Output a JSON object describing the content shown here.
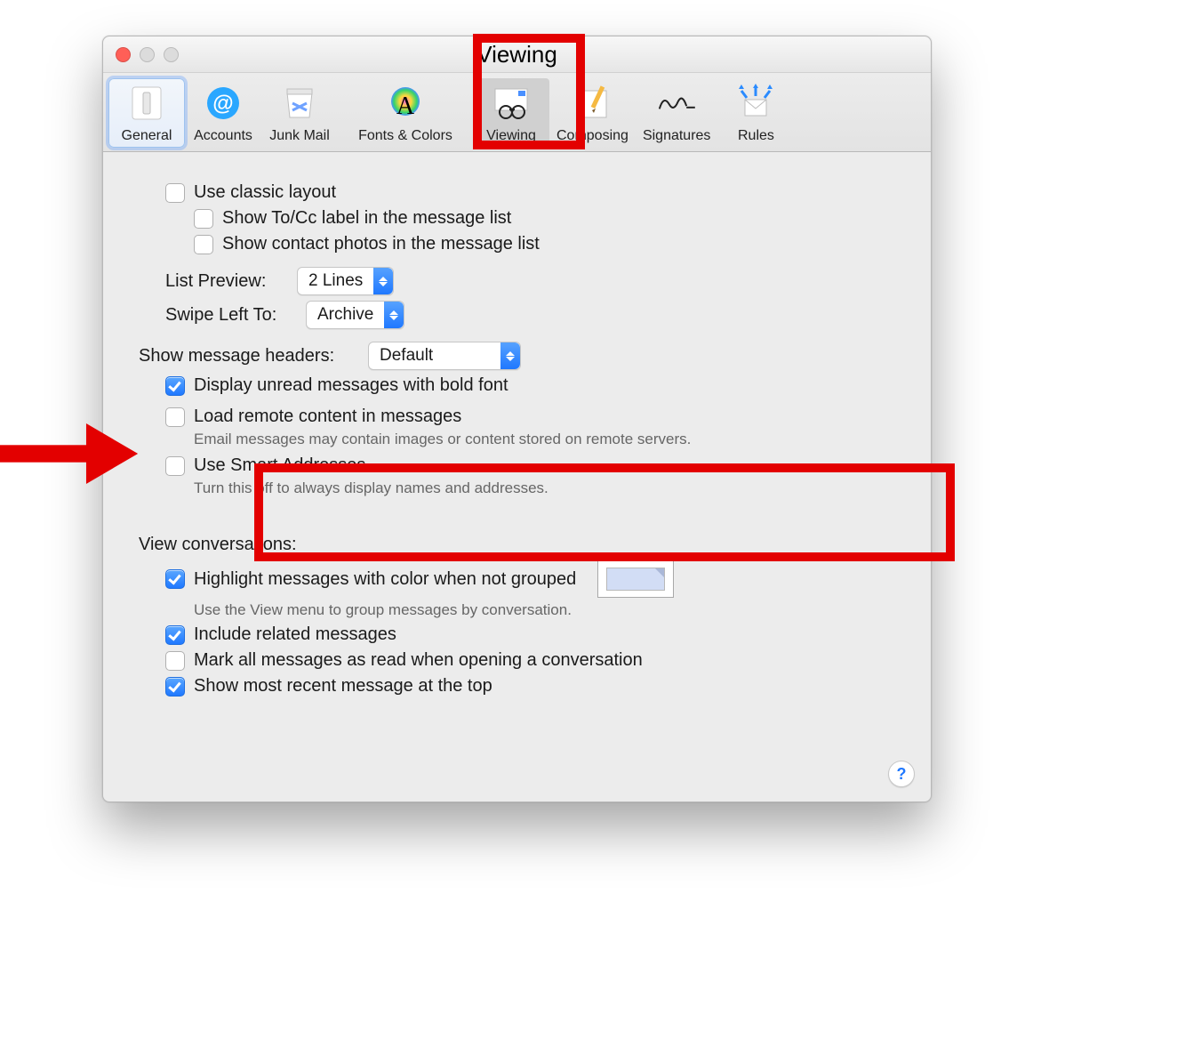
{
  "window": {
    "title": "Viewing"
  },
  "toolbar": {
    "items": [
      {
        "key": "general",
        "label": "General"
      },
      {
        "key": "accounts",
        "label": "Accounts"
      },
      {
        "key": "junk",
        "label": "Junk Mail"
      },
      {
        "key": "fonts",
        "label": "Fonts & Colors"
      },
      {
        "key": "viewing",
        "label": "Viewing"
      },
      {
        "key": "composing",
        "label": "Composing"
      },
      {
        "key": "signatures",
        "label": "Signatures"
      },
      {
        "key": "rules",
        "label": "Rules"
      }
    ]
  },
  "options": {
    "classic_layout": {
      "label": "Use classic layout",
      "checked": false
    },
    "show_to_cc": {
      "label": "Show To/Cc label in the message list",
      "checked": false
    },
    "show_contact_photos": {
      "label": "Show contact photos in the message list",
      "checked": false
    },
    "list_preview": {
      "label": "List Preview:",
      "value": "2 Lines"
    },
    "swipe_left": {
      "label": "Swipe Left To:",
      "value": "Archive"
    },
    "show_headers": {
      "label": "Show message headers:",
      "value": "Default"
    },
    "display_bold": {
      "label": "Display unread messages with bold font",
      "checked": true
    },
    "load_remote": {
      "label": "Load remote content in messages",
      "checked": false,
      "sub": "Email messages may contain images or content stored on remote servers."
    },
    "smart_addresses": {
      "label": "Use Smart Addresses",
      "checked": false,
      "sub": "Turn this off to always display names and addresses."
    },
    "view_conv_header": "View conversations:",
    "highlight": {
      "label": "Highlight messages with color when not grouped",
      "checked": true,
      "sub": "Use the View menu to group messages by conversation."
    },
    "include_related": {
      "label": "Include related messages",
      "checked": true
    },
    "mark_read": {
      "label": "Mark all messages as read when opening a conversation",
      "checked": false
    },
    "recent_top": {
      "label": "Show most recent message at the top",
      "checked": true
    }
  },
  "help": "?"
}
